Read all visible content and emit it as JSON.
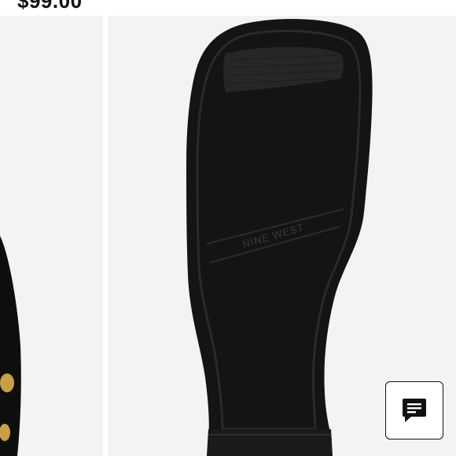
{
  "product": {
    "price": "$99.00"
  },
  "gallery": {
    "thumbnail_alt": "Loafer side view with gold hardware",
    "main_image_alt": "Black suede loafer sole",
    "sole_brand_text": "NINE WEST"
  },
  "chat": {
    "icon": "chat-bubble-icon"
  },
  "colors": {
    "image_background": "#f3f3f3",
    "shoe": "#111111",
    "hardware_gold": "#c9a046"
  }
}
